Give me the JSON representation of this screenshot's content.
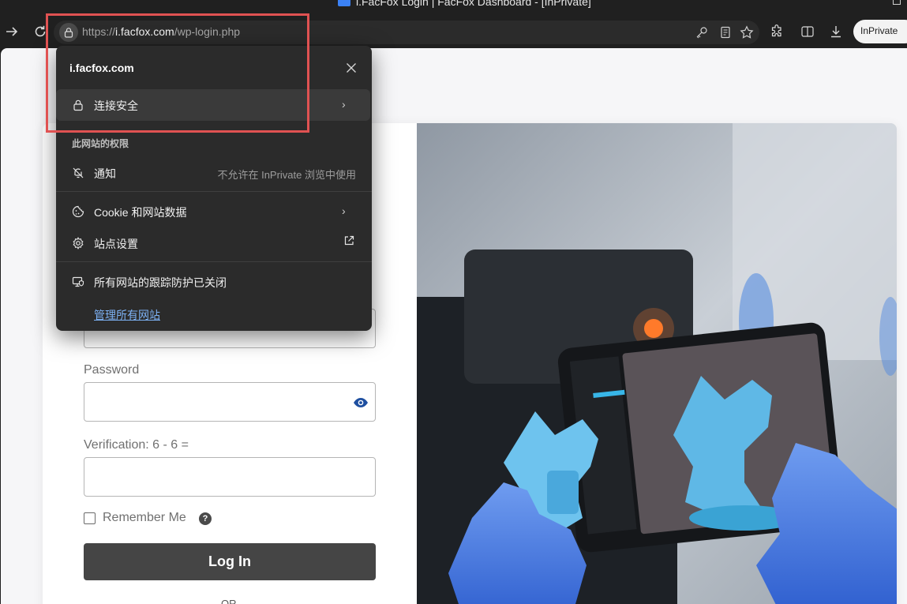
{
  "window": {
    "title": "i.FacFox Login | FacFox Dashboard - [InPrivate]"
  },
  "address_bar": {
    "scheme": "https://",
    "host": "i.facfox.com",
    "path": "/wp-login.php"
  },
  "profile": {
    "label": "InPrivate"
  },
  "site_info": {
    "host": "i.facfox.com",
    "connection": "连接安全",
    "permissions_header": "此网站的权限",
    "notifications": {
      "label": "通知",
      "status": "不允许在 InPrivate 浏览中使用"
    },
    "cookies": "Cookie 和网站数据",
    "site_settings": "站点设置",
    "tracking": "所有网站的跟踪防护已关闭",
    "manage_link": "管理所有网站"
  },
  "login_form": {
    "password_label": "Password",
    "verification_label": "Verification: 6 - 6 =",
    "remember_label": "Remember Me",
    "help_glyph": "?",
    "login_button": "Log In",
    "or_text": "OR"
  },
  "colors": {
    "highlight": "#e05252",
    "accent_link": "#7db2f5",
    "button": "#454545"
  }
}
